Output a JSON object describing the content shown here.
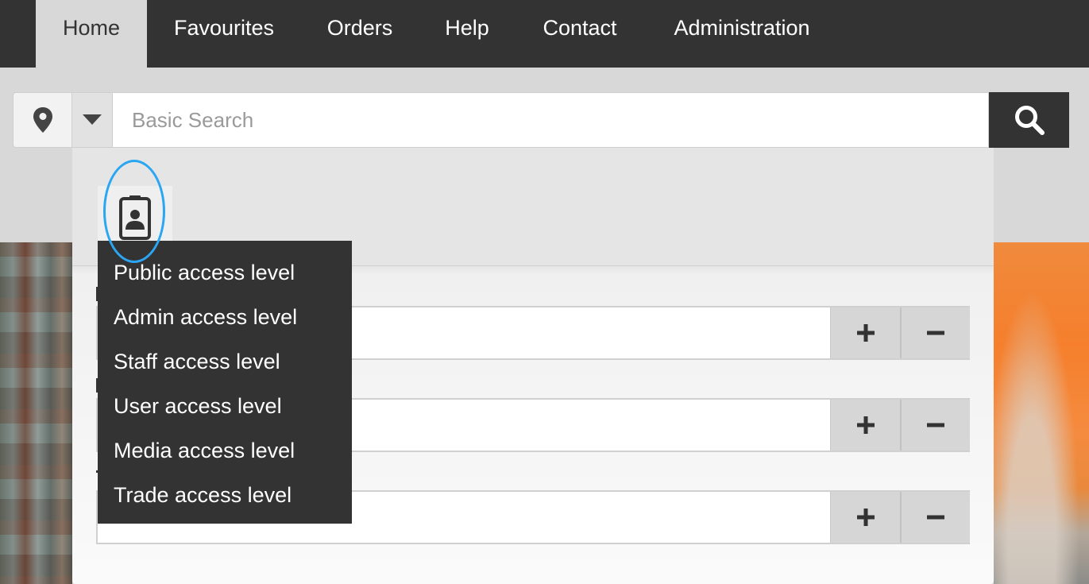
{
  "nav": {
    "tabs": [
      {
        "label": "Home",
        "active": true
      },
      {
        "label": "Favourites"
      },
      {
        "label": "Orders"
      },
      {
        "label": "Help"
      },
      {
        "label": "Contact"
      },
      {
        "label": "Administration"
      }
    ]
  },
  "search": {
    "placeholder": "Basic Search",
    "location_icon": "map-pin-icon",
    "dropdown_icon": "caret-down-icon",
    "search_icon": "magnifier-icon"
  },
  "panel": {
    "access_icon": "id-badge-icon",
    "rows": [
      {
        "plus": "+",
        "minus": "−"
      },
      {
        "plus": "+",
        "minus": "−"
      },
      {
        "plus": "+",
        "minus": "−"
      }
    ]
  },
  "access_menu": {
    "items": [
      "Public access level",
      "Admin access level",
      "Staff access level",
      "User access level",
      "Media access level",
      "Trade access level"
    ]
  },
  "colors": {
    "nav_bg": "#333333",
    "highlight": "#2aa6f2",
    "menu_bg": "#333333"
  }
}
